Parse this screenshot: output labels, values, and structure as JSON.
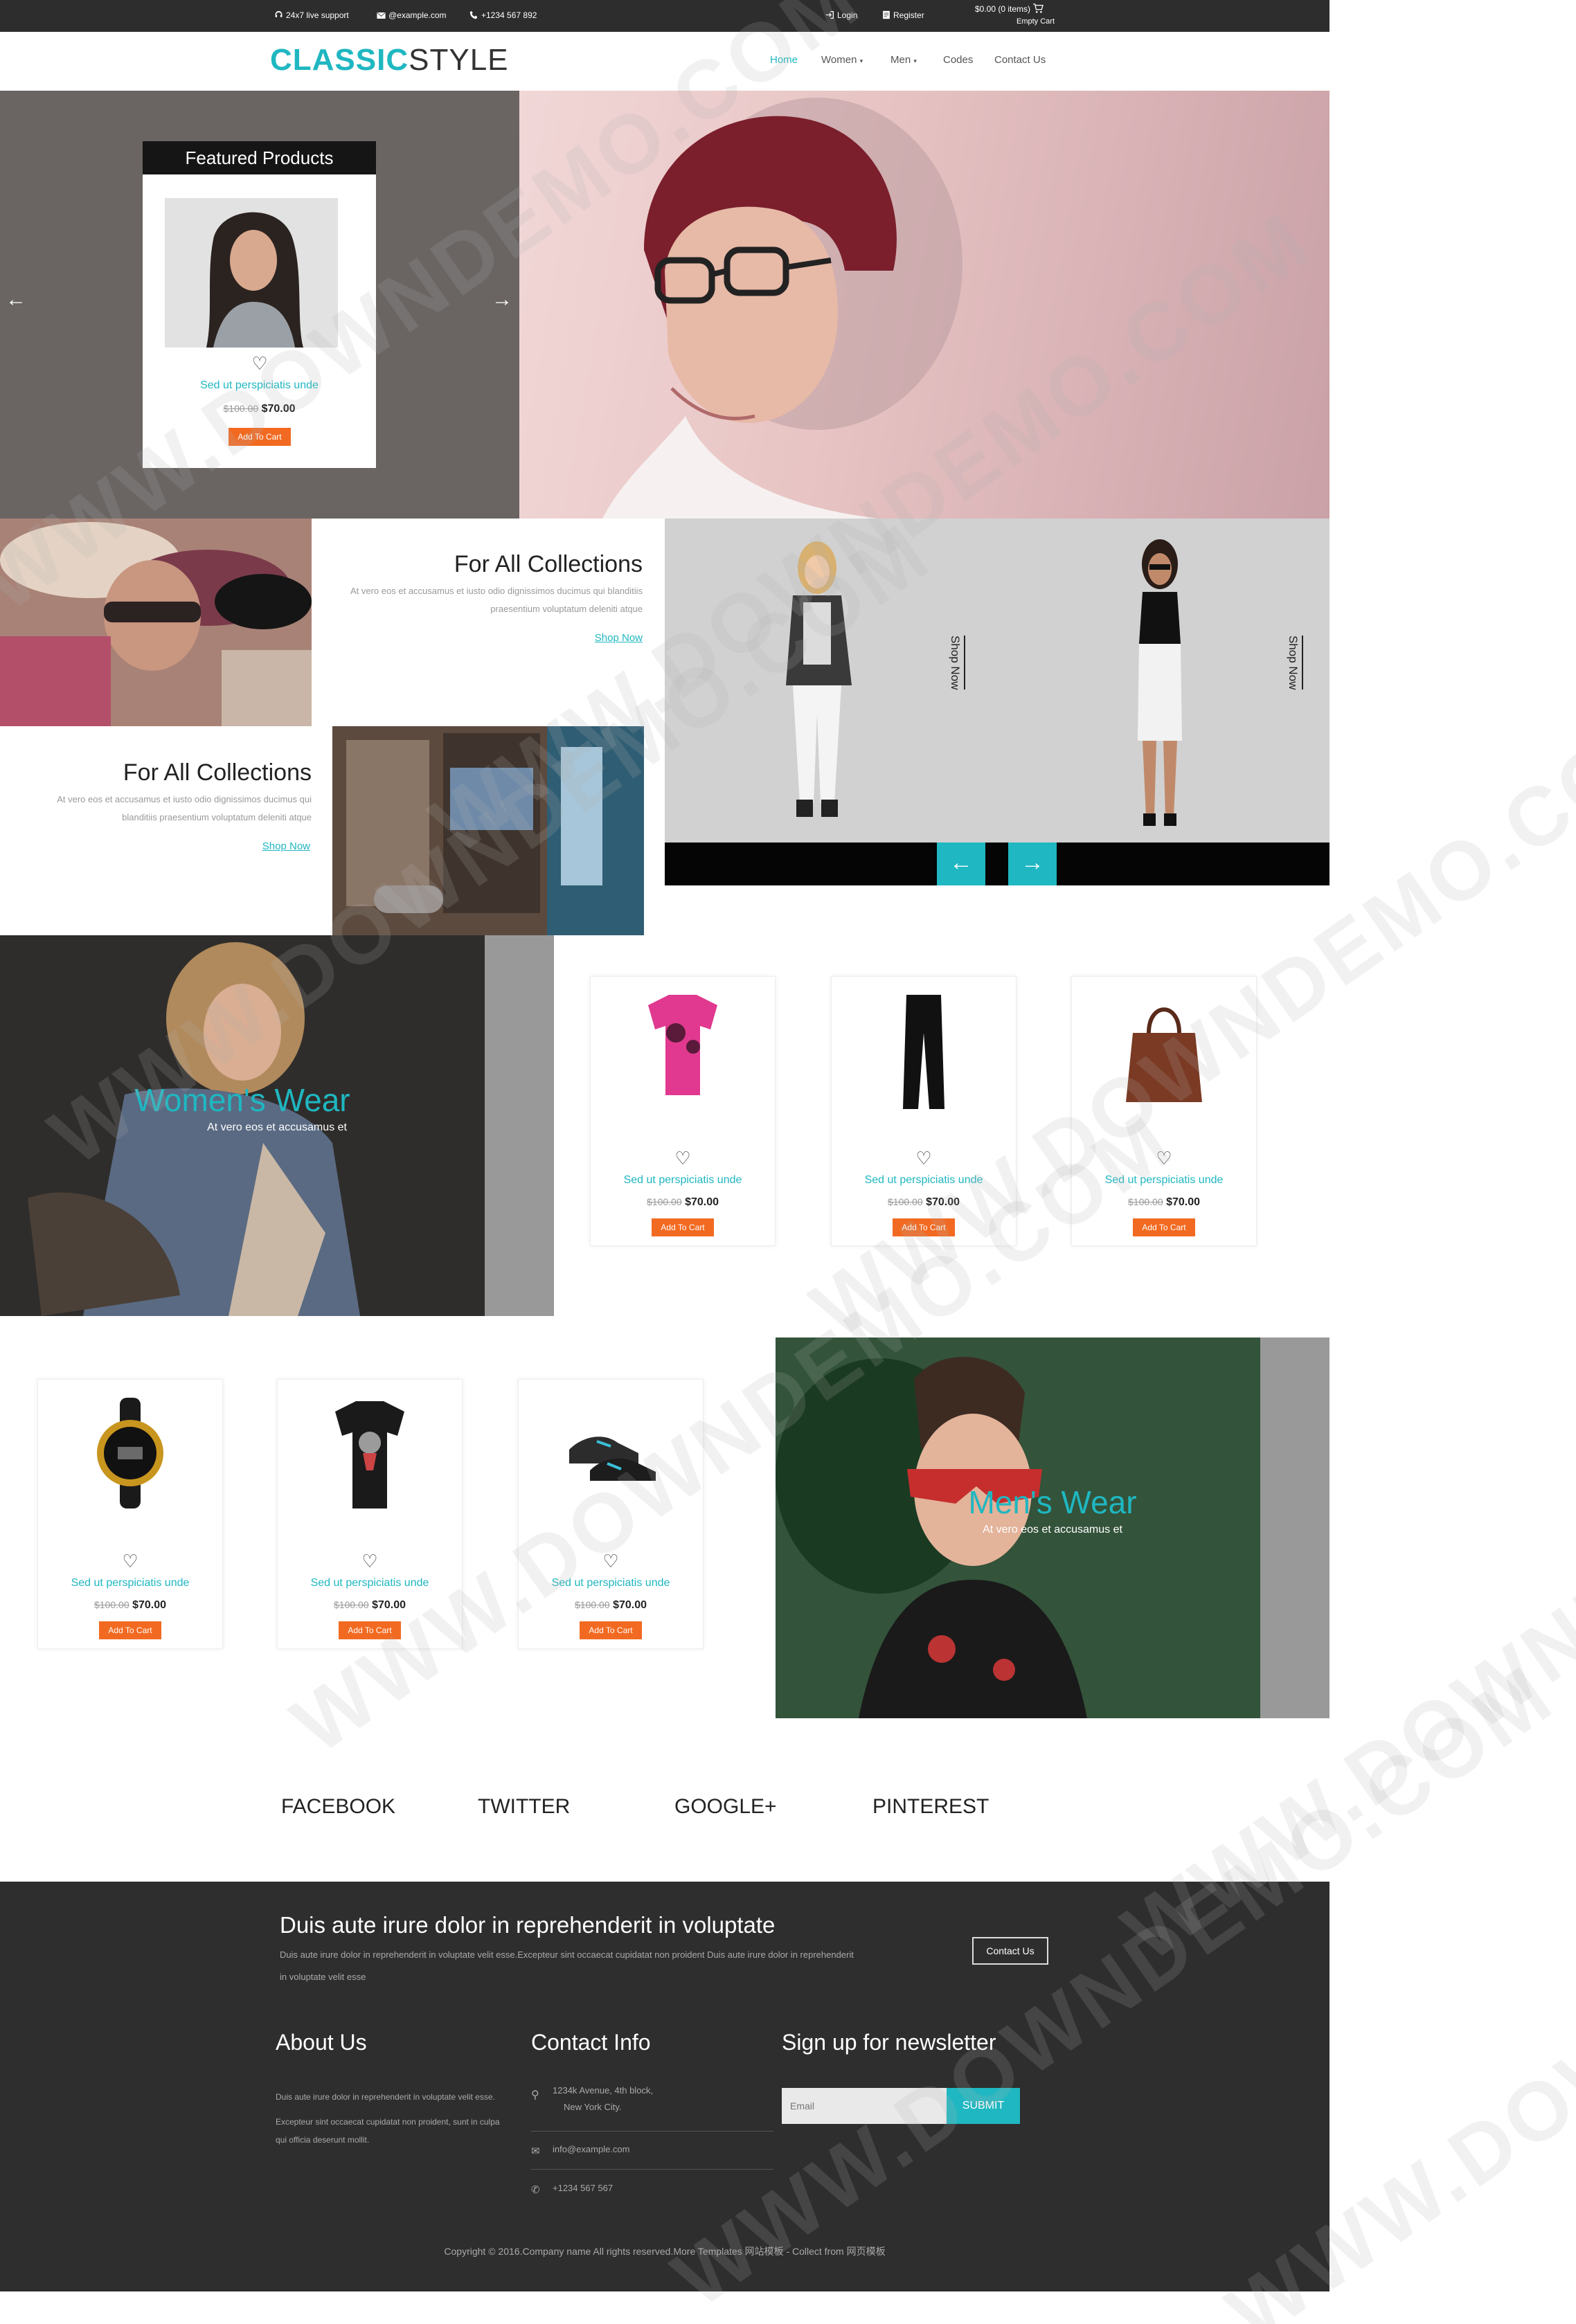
{
  "topbar": {
    "support": "24x7 live support",
    "email": "@example.com",
    "phone": "+1234 567 892",
    "login": "Login",
    "register": "Register",
    "cart_total": "$0.00 (0 items)",
    "cart_status": "Empty Cart"
  },
  "logo": {
    "part1": "CLASSIC",
    "part2": "STYLE"
  },
  "nav": {
    "home": "Home",
    "women": "Women",
    "men": "Men",
    "codes": "Codes",
    "contact": "Contact Us"
  },
  "featured": {
    "title": "Featured Products",
    "product_name": "Sed ut perspiciatis unde",
    "old_price": "$100.00",
    "price": "$70.00",
    "button": "Add To Cart"
  },
  "collections": [
    {
      "title": "For All Collections",
      "text": "At vero eos et accusamus et iusto odio dignissimos ducimus qui blanditiis praesentium voluptatum deleniti atque",
      "link": "Shop Now"
    },
    {
      "title": "For All Collections",
      "text": "At vero eos et accusamus et iusto odio dignissimos ducimus qui blanditiis praesentium voluptatum deleniti atque",
      "link": "Shop Now"
    }
  ],
  "models": {
    "shop1": "Shop Now",
    "shop2": "Shop Now"
  },
  "womens": {
    "title": "Women's Wear",
    "sub": "At vero eos et accusamus et"
  },
  "mens": {
    "title": "Men's Wear",
    "sub": "At vero eos et accusamus et"
  },
  "products_row1": [
    {
      "name": "Sed ut perspiciatis unde",
      "old": "$100.00",
      "price": "$70.00",
      "btn": "Add To Cart",
      "icon": "tshirt-pink"
    },
    {
      "name": "Sed ut perspiciatis unde",
      "old": "$100.00",
      "price": "$70.00",
      "btn": "Add To Cart",
      "icon": "pants-black"
    },
    {
      "name": "Sed ut perspiciatis unde",
      "old": "$100.00",
      "price": "$70.00",
      "btn": "Add To Cart",
      "icon": "handbag-brown"
    }
  ],
  "products_row2": [
    {
      "name": "Sed ut perspiciatis unde",
      "old": "$100.00",
      "price": "$70.00",
      "btn": "Add To Cart",
      "icon": "watch"
    },
    {
      "name": "Sed ut perspiciatis unde",
      "old": "$100.00",
      "price": "$70.00",
      "btn": "Add To Cart",
      "icon": "tshirt-black"
    },
    {
      "name": "Sed ut perspiciatis unde",
      "old": "$100.00",
      "price": "$70.00",
      "btn": "Add To Cart",
      "icon": "sneakers"
    }
  ],
  "social": {
    "facebook": "FACEBOOK",
    "twitter": "TWITTER",
    "google": "GOOGLE+",
    "pinterest": "PINTEREST"
  },
  "footer": {
    "headline": "Duis aute irure dolor in reprehenderit in voluptate",
    "headline_text": "Duis aute irure dolor in reprehenderit in voluptate velit esse.Excepteur sint occaecat cupidatat non proident Duis aute irure dolor in reprehenderit in voluptate velit esse",
    "contact_btn": "Contact Us",
    "about_title": "About Us",
    "about_text1": "Duis aute irure dolor in reprehenderit in voluptate velit esse.",
    "about_text2": "Excepteur sint occaecat cupidatat non proident, sunt in culpa qui officia deserunt mollit.",
    "contact_title": "Contact Info",
    "address1": "1234k Avenue, 4th block,",
    "address2": "New York City.",
    "email": "info@example.com",
    "phone": "+1234 567 567",
    "newsletter_title": "Sign up for newsletter",
    "email_placeholder": "Email",
    "submit": "SUBMIT",
    "copyright": "Copyright © 2016.Company name All rights reserved.More Templates 网站模板 - Collect from 网页模板"
  },
  "watermark": "WWW.DOWNDEMO.COM",
  "colors": {
    "accent": "#1fb7c1",
    "cart_button": "#f26a21",
    "dark": "#2e2e2e"
  }
}
